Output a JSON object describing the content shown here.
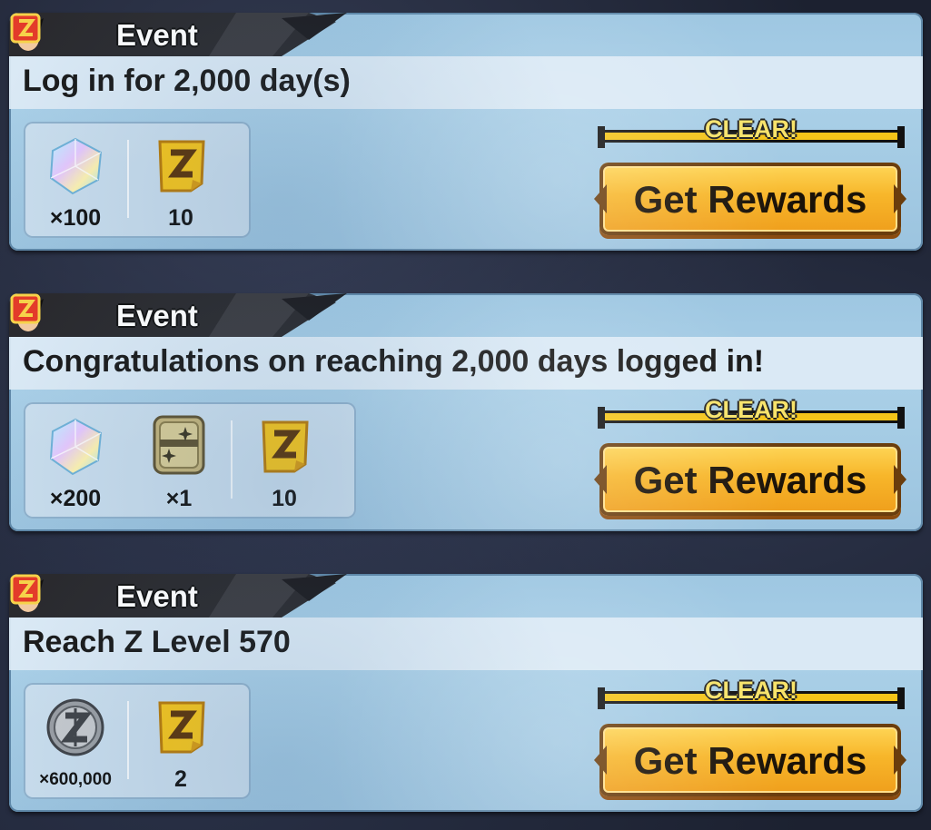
{
  "missions": [
    {
      "category": "Event",
      "title": "Log in for 2,000 day(s)",
      "rewards": [
        {
          "icon": "chrono-crystal-icon",
          "qty": "×100"
        },
        {
          "icon": "z-power-ticket-icon",
          "qty": "10"
        }
      ],
      "status": "CLEAR!",
      "button": "Get Rewards"
    },
    {
      "category": "Event",
      "title": "Congratulations on reaching 2,000 days logged in!",
      "rewards": [
        {
          "icon": "chrono-crystal-icon",
          "qty": "×200"
        },
        {
          "icon": "gold-plate-icon",
          "qty": "×1"
        },
        {
          "icon": "z-power-ticket-icon",
          "qty": "10"
        }
      ],
      "status": "CLEAR!",
      "button": "Get Rewards"
    },
    {
      "category": "Event",
      "title": "Reach Z Level 570",
      "rewards": [
        {
          "icon": "zeni-coin-icon",
          "qty": "×600,000"
        },
        {
          "icon": "z-power-ticket-icon",
          "qty": "2"
        }
      ],
      "status": "CLEAR!",
      "button": "Get Rewards"
    }
  ],
  "colors": {
    "card_blue": "#a9cfe7",
    "button_gold": "#f7b62a",
    "clear_bar": "#f4c419"
  }
}
